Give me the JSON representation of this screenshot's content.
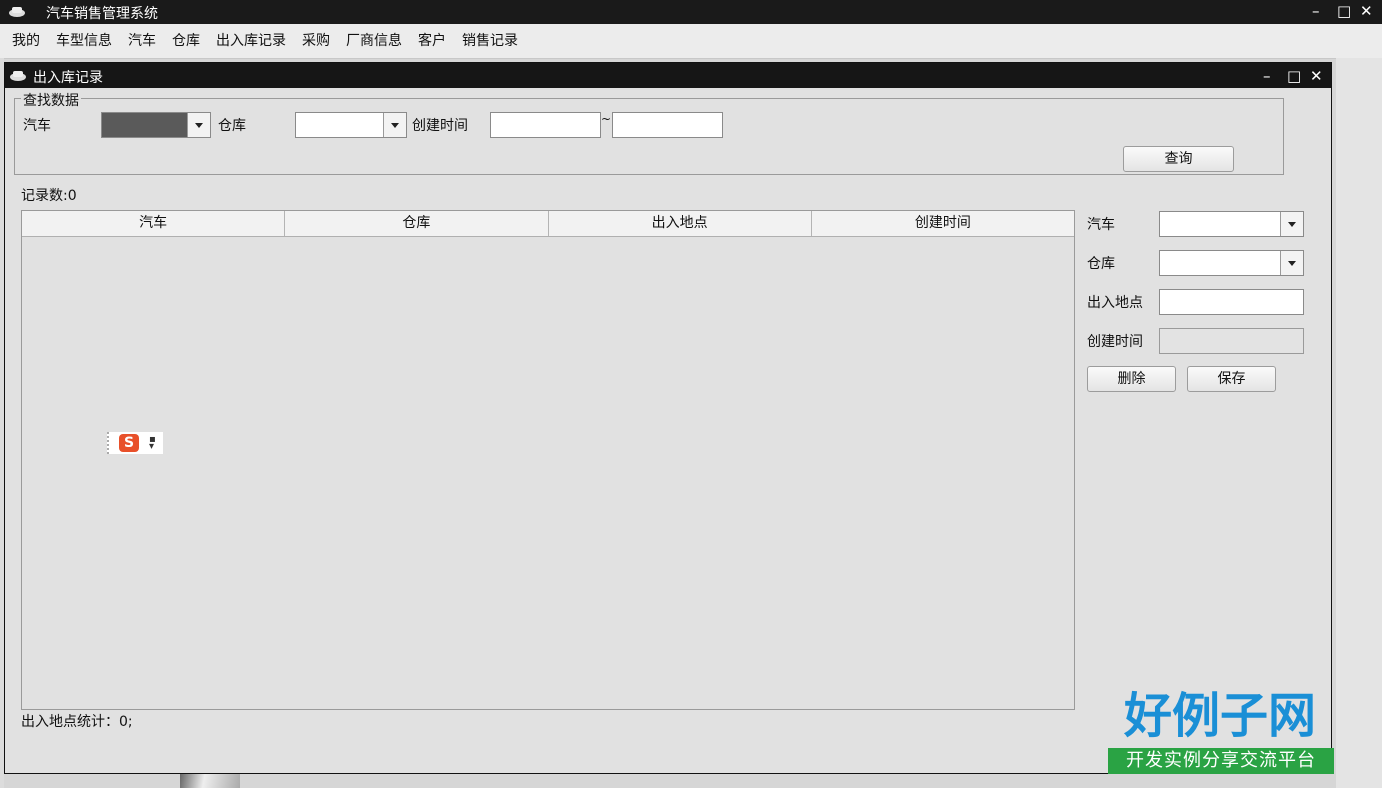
{
  "app": {
    "title": "汽车销售管理系统"
  },
  "window_controls": {
    "minimize": "–",
    "maximize": "□",
    "close": "✕"
  },
  "menu": {
    "items": [
      "我的",
      "车型信息",
      "汽车",
      "仓库",
      "出入库记录",
      "采购",
      "厂商信息",
      "客户",
      "销售记录"
    ]
  },
  "inner_window": {
    "title": "出入库记录"
  },
  "search": {
    "legend": "查找数据",
    "car_label": "汽车",
    "warehouse_label": "仓库",
    "created_label": "创建时间",
    "range_sep": "~",
    "query_button": "查询"
  },
  "record_count": "记录数:0",
  "table": {
    "columns": [
      "汽车",
      "仓库",
      "出入地点",
      "创建时间"
    ],
    "rows": []
  },
  "form": {
    "car_label": "汽车",
    "warehouse_label": "仓库",
    "location_label": "出入地点",
    "created_label": "创建时间",
    "delete_button": "删除",
    "save_button": "保存"
  },
  "footer": {
    "stats": "出入地点统计：0;"
  },
  "ime": {
    "logo": "S"
  },
  "watermark": {
    "main": "好例子网",
    "sub": "开发实例分享交流平台"
  },
  "colors": {
    "watermark_blue": "#1a8fd6",
    "watermark_green": "#2aa344",
    "ime_orange": "#e8502a"
  }
}
